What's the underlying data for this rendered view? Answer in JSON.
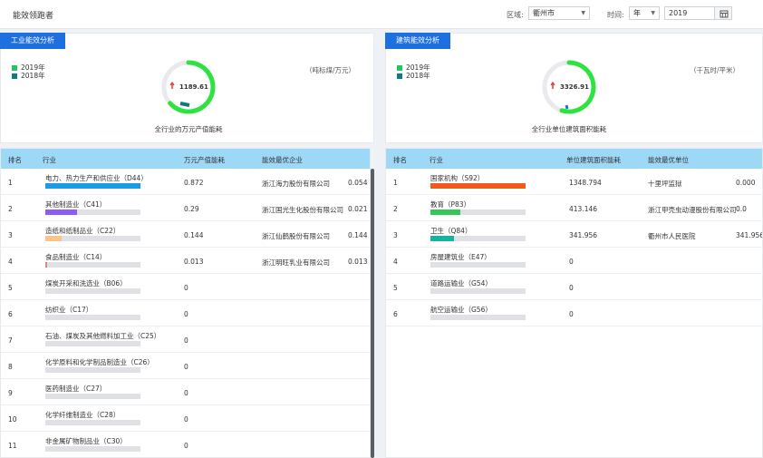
{
  "header": {
    "title": "能效领跑者",
    "region_label": "区域:",
    "region_value": "衢州市",
    "time_label": "时间:",
    "time_unit_value": "年",
    "year_value": "2019"
  },
  "industrial": {
    "tab": "工业能效分析",
    "legend": [
      {
        "label": "2019年",
        "color": "#22c55e"
      },
      {
        "label": "2018年",
        "color": "#0f7a86"
      }
    ],
    "unit": "（吨标煤/万元）",
    "gauge_value": "1189.61",
    "gauge_level": 0.9,
    "caption": "全行业的万元产值能耗",
    "columns": [
      "排名",
      "行业",
      "万元产值能耗",
      "能效最优企业"
    ],
    "rows": [
      {
        "rank": "1",
        "name": "电力、热力生产和供应业（D44）",
        "value": "0.872",
        "firm": "浙江海力股份有限公司",
        "firm_value": "0.054",
        "bar_color": "#1a9be6",
        "level": 1.0
      },
      {
        "rank": "2",
        "name": "其他制造业（C41）",
        "value": "0.29",
        "firm": "浙江国光生化股份有限公司",
        "firm_value": "0.021",
        "bar_color": "#8b5cf6",
        "level": 0.33
      },
      {
        "rank": "3",
        "name": "造纸和纸制品业（C22）",
        "value": "0.144",
        "firm": "浙江仙鹤股份有限公司",
        "firm_value": "0.144",
        "bar_color": "#f9c58a",
        "level": 0.17
      },
      {
        "rank": "4",
        "name": "食品制造业（C14）",
        "value": "0.013",
        "firm": "浙江明旺乳业有限公司",
        "firm_value": "0.013",
        "bar_color": "#f08080",
        "level": 0.02
      },
      {
        "rank": "5",
        "name": "煤炭开采和洗选业（B06）",
        "value": "0",
        "firm": "",
        "firm_value": "",
        "bar_color": "#dfe1e4",
        "level": 0
      },
      {
        "rank": "6",
        "name": "纺织业（C17）",
        "value": "0",
        "firm": "",
        "firm_value": "",
        "bar_color": "#dfe1e4",
        "level": 0
      },
      {
        "rank": "7",
        "name": "石油、煤炭及其他燃料加工业（C25）",
        "value": "0",
        "firm": "",
        "firm_value": "",
        "bar_color": "#dfe1e4",
        "level": 0
      },
      {
        "rank": "8",
        "name": "化学原料和化学制品制造业（C26）",
        "value": "0",
        "firm": "",
        "firm_value": "",
        "bar_color": "#dfe1e4",
        "level": 0
      },
      {
        "rank": "9",
        "name": "医药制造业（C27）",
        "value": "0",
        "firm": "",
        "firm_value": "",
        "bar_color": "#dfe1e4",
        "level": 0
      },
      {
        "rank": "10",
        "name": "化学纤维制造业（C28）",
        "value": "0",
        "firm": "",
        "firm_value": "",
        "bar_color": "#dfe1e4",
        "level": 0
      },
      {
        "rank": "11",
        "name": "非金属矿物制品业（C30）",
        "value": "0",
        "firm": "",
        "firm_value": "",
        "bar_color": "#dfe1e4",
        "level": 0
      }
    ]
  },
  "building": {
    "tab": "建筑能效分析",
    "legend": [
      {
        "label": "2019年",
        "color": "#22c55e"
      },
      {
        "label": "2018年",
        "color": "#0f7a86"
      }
    ],
    "unit": "（千瓦时/平米）",
    "gauge_value": "3326.91",
    "gauge_level": 0.9,
    "caption": "全行业单位建筑面积能耗",
    "columns": [
      "排名",
      "行业",
      "单位建筑面积能耗",
      "能效最优单位"
    ],
    "rows": [
      {
        "rank": "1",
        "name": "国家机构（S92）",
        "value": "1348.794",
        "firm": "十里坪监狱",
        "firm_value": "0.000",
        "bar_color": "#f05a1a",
        "level": 1.0
      },
      {
        "rank": "2",
        "name": "教育（P83）",
        "value": "413.146",
        "firm": "浙江甲壳虫动漫股份有限公司",
        "firm_value": "0.0",
        "bar_color": "#34c759",
        "level": 0.31
      },
      {
        "rank": "3",
        "name": "卫生（Q84）",
        "value": "341.956",
        "firm": "衢州市人民医院",
        "firm_value": "341.956",
        "bar_color": "#16b3a3",
        "level": 0.25
      },
      {
        "rank": "4",
        "name": "房屋建筑业（E47）",
        "value": "0",
        "firm": "",
        "firm_value": "",
        "bar_color": "#dfe1e4",
        "level": 0
      },
      {
        "rank": "5",
        "name": "道路运输业（G54）",
        "value": "0",
        "firm": "",
        "firm_value": "",
        "bar_color": "#dfe1e4",
        "level": 0
      },
      {
        "rank": "6",
        "name": "航空运输业（G56）",
        "value": "0",
        "firm": "",
        "firm_value": "",
        "bar_color": "#dfe1e4",
        "level": 0
      }
    ]
  }
}
